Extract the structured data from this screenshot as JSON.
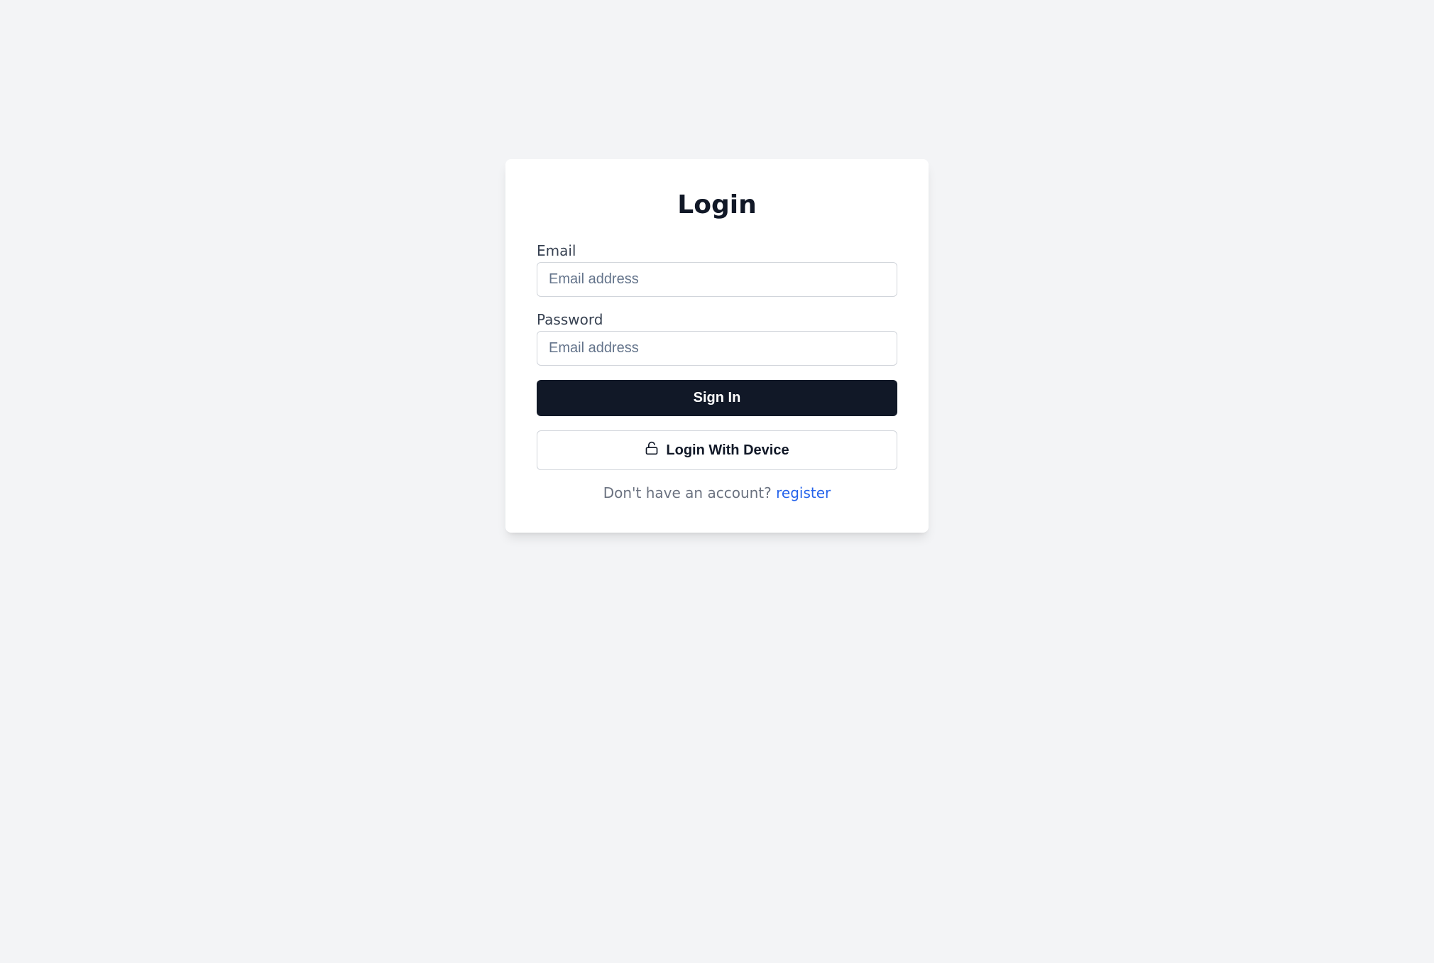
{
  "title": "Login",
  "fields": {
    "email": {
      "label": "Email",
      "placeholder": "Email address",
      "value": ""
    },
    "password": {
      "label": "Password",
      "placeholder": "Email address",
      "value": ""
    }
  },
  "buttons": {
    "sign_in": "Sign In",
    "login_device": "Login With Device"
  },
  "footer": {
    "prompt": "Don't have an account? ",
    "link": "register"
  }
}
